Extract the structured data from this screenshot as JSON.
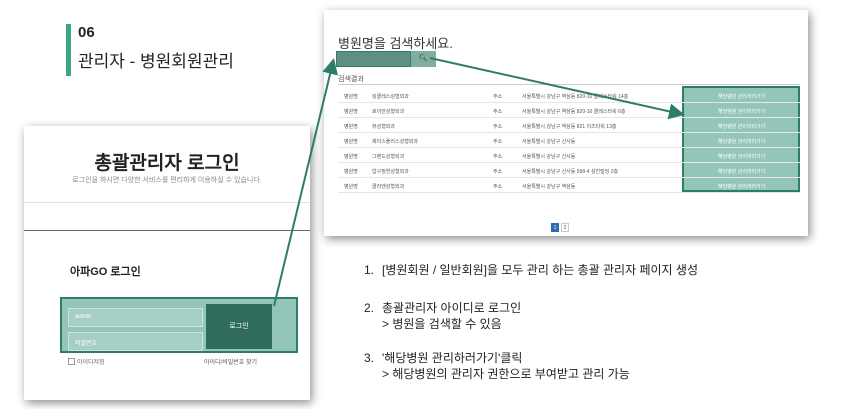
{
  "section": {
    "number": "06",
    "title": "관리자 - 병원회원관리"
  },
  "login": {
    "title": "총괄관리자 로그인",
    "subtitle": "로그인을 하시면 다양한 서비스를 편리하게 이용하실 수 있습니다.",
    "box_title": "아파GO 로그인",
    "id_placeholder": "admin",
    "password_placeholder": "비밀번호",
    "login_button": "로그인",
    "remember_label": "아이디저장",
    "find_link": "아이디/비밀번호 찾기"
  },
  "search": {
    "title": "병원명을 검색하세요.",
    "search_icon": "magnifier-icon",
    "results_label": "검색결과",
    "rows": [
      {
        "type": "병원명",
        "name": "킹클레스성형외과",
        "addr_label": "주소",
        "address": "서울특별시 강남구 역삼동 820-10 클레스타워 14층",
        "link": "해당병원 관리하러가기"
      },
      {
        "type": "병원명",
        "name": "로이안성형외과",
        "addr_label": "주소",
        "address": "서울특별시 강남구 역삼동 820-10 클레스타워 6층",
        "link": "해당병원 관리하러가기"
      },
      {
        "type": "병원명",
        "name": "뷰성형외과",
        "addr_label": "주소",
        "address": "서울특별시 강남구 역삼동 821 이즈타워 13층",
        "link": "해당병원 관리하러가기"
      },
      {
        "type": "병원명",
        "name": "제이스플러스성형외과",
        "addr_label": "주소",
        "address": "서울특별시 강남구 신사동",
        "link": "해당병원 관리하러가기"
      },
      {
        "type": "병원명",
        "name": "그랜드성형외과",
        "addr_label": "주소",
        "address": "서울특별시 강남구 신사동",
        "link": "해당병원 관리하러가기"
      },
      {
        "type": "병원명",
        "name": "압구정연성형외과",
        "addr_label": "주소",
        "address": "서울특별시 강남구 신사동 598-4 삼진빌딩 2층",
        "link": "해당병원 관리하러가기"
      },
      {
        "type": "병원명",
        "name": "클리앤성형외과",
        "addr_label": "주소",
        "address": "서울특별시 강남구 역삼동",
        "link": "해당병원 관리하러가기"
      }
    ],
    "pages": [
      "1",
      "2"
    ]
  },
  "steps": [
    {
      "num": "1.",
      "text": "[병원회원 / 일반회원]을 모두 관리 하는 총괄 관리자 페이지 생성",
      "sub": ""
    },
    {
      "num": "2.",
      "text": "총괄관리자 아이디로 로그인",
      "sub": "> 병원을 검색할 수 있음"
    },
    {
      "num": "3.",
      "text": "'해당병원 관리하러가기'클릭",
      "sub": "> 해당병원의 관리자 권한으로 부여받고 관리 가능"
    }
  ],
  "colors": {
    "accent": "#3aa789",
    "highlight_border": "#2e7d6a",
    "page_active": "#2d6bb3"
  }
}
